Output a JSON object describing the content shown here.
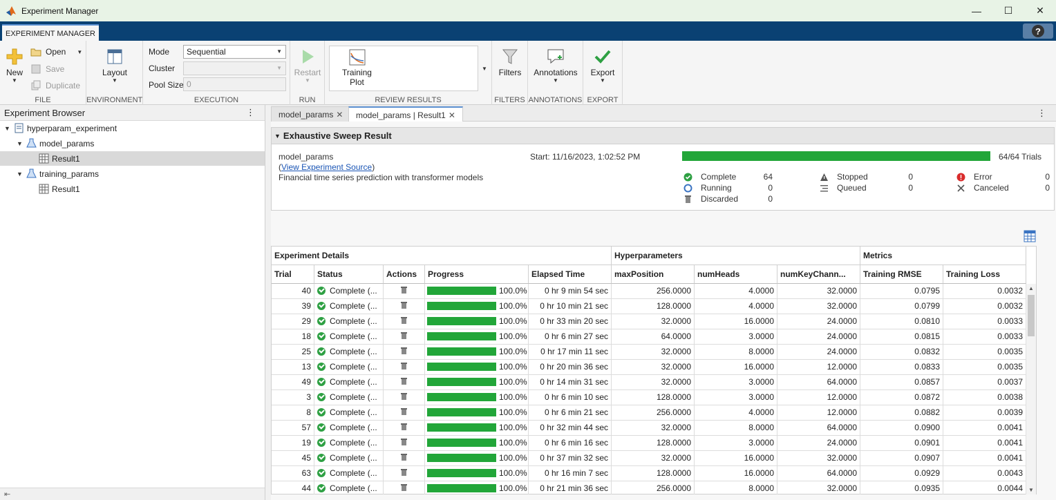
{
  "window": {
    "title": "Experiment Manager",
    "minimize": "—",
    "maximize": "☐",
    "close": "✕"
  },
  "app_tab": "EXPERIMENT MANAGER",
  "help": "?",
  "toolstrip": {
    "file": {
      "label": "FILE",
      "new": "New",
      "open": "Open",
      "save": "Save",
      "duplicate": "Duplicate"
    },
    "environment": {
      "label": "ENVIRONMENT",
      "layout": "Layout"
    },
    "execution": {
      "label": "EXECUTION",
      "mode_label": "Mode",
      "mode_value": "Sequential",
      "cluster_label": "Cluster",
      "cluster_value": "",
      "pool_label": "Pool Size",
      "pool_value": "0"
    },
    "run": {
      "label": "RUN",
      "restart": "Restart"
    },
    "review": {
      "label": "REVIEW RESULTS",
      "training_plot_1": "Training",
      "training_plot_2": "Plot"
    },
    "filters": {
      "label": "FILTERS",
      "button": "Filters"
    },
    "annotations": {
      "label": "ANNOTATIONS",
      "button": "Annotations"
    },
    "export": {
      "label": "EXPORT",
      "button": "Export"
    }
  },
  "browser": {
    "title": "Experiment Browser",
    "items": [
      {
        "label": "hyperparam_experiment"
      },
      {
        "label": "model_params"
      },
      {
        "label": "Result1"
      },
      {
        "label": "training_params"
      },
      {
        "label": "Result1"
      }
    ]
  },
  "doc_tabs": [
    {
      "label": "model_params"
    },
    {
      "label": "model_params | Result1"
    }
  ],
  "sweep": {
    "title": "Exhaustive Sweep Result",
    "experiment": "model_params",
    "link": "View Experiment Source",
    "description": "Financial time series prediction with transformer models",
    "start": "Start: 11/16/2023, 1:02:52 PM",
    "progress": 1.0,
    "trials": "64/64 Trials",
    "stats": {
      "complete_label": "Complete",
      "complete": "64",
      "running_label": "Running",
      "running": "0",
      "discarded_label": "Discarded",
      "discarded": "0",
      "stopped_label": "Stopped",
      "stopped": "0",
      "queued_label": "Queued",
      "queued": "0",
      "error_label": "Error",
      "error": "0",
      "canceled_label": "Canceled",
      "canceled": "0"
    },
    "colors": {
      "complete": "#2ea043",
      "error": "#d92c2c",
      "progress": "#22a639"
    }
  },
  "table": {
    "groups": [
      "Experiment Details",
      "Hyperparameters",
      "Metrics"
    ],
    "columns": [
      "Trial",
      "Status",
      "Actions",
      "Progress",
      "Elapsed Time",
      "maxPosition",
      "numHeads",
      "numKeyChann...",
      "Training RMSE",
      "Training Loss"
    ],
    "rows": [
      {
        "trial": "40",
        "status": "Complete (...",
        "progress": "100.0%",
        "elapsed": "0 hr 9 min 54 sec",
        "maxPosition": "256.0000",
        "numHeads": "4.0000",
        "numKey": "32.0000",
        "rmse": "0.0795",
        "loss": "0.0032"
      },
      {
        "trial": "39",
        "status": "Complete (...",
        "progress": "100.0%",
        "elapsed": "0 hr 10 min 21 sec",
        "maxPosition": "128.0000",
        "numHeads": "4.0000",
        "numKey": "32.0000",
        "rmse": "0.0799",
        "loss": "0.0032"
      },
      {
        "trial": "29",
        "status": "Complete (...",
        "progress": "100.0%",
        "elapsed": "0 hr 33 min 20 sec",
        "maxPosition": "32.0000",
        "numHeads": "16.0000",
        "numKey": "24.0000",
        "rmse": "0.0810",
        "loss": "0.0033"
      },
      {
        "trial": "18",
        "status": "Complete (...",
        "progress": "100.0%",
        "elapsed": "0 hr 6 min 27 sec",
        "maxPosition": "64.0000",
        "numHeads": "3.0000",
        "numKey": "24.0000",
        "rmse": "0.0815",
        "loss": "0.0033"
      },
      {
        "trial": "25",
        "status": "Complete (...",
        "progress": "100.0%",
        "elapsed": "0 hr 17 min 11 sec",
        "maxPosition": "32.0000",
        "numHeads": "8.0000",
        "numKey": "24.0000",
        "rmse": "0.0832",
        "loss": "0.0035"
      },
      {
        "trial": "13",
        "status": "Complete (...",
        "progress": "100.0%",
        "elapsed": "0 hr 20 min 36 sec",
        "maxPosition": "32.0000",
        "numHeads": "16.0000",
        "numKey": "12.0000",
        "rmse": "0.0833",
        "loss": "0.0035"
      },
      {
        "trial": "49",
        "status": "Complete (...",
        "progress": "100.0%",
        "elapsed": "0 hr 14 min 31 sec",
        "maxPosition": "32.0000",
        "numHeads": "3.0000",
        "numKey": "64.0000",
        "rmse": "0.0857",
        "loss": "0.0037"
      },
      {
        "trial": "3",
        "status": "Complete (...",
        "progress": "100.0%",
        "elapsed": "0 hr 6 min 10 sec",
        "maxPosition": "128.0000",
        "numHeads": "3.0000",
        "numKey": "12.0000",
        "rmse": "0.0872",
        "loss": "0.0038"
      },
      {
        "trial": "8",
        "status": "Complete (...",
        "progress": "100.0%",
        "elapsed": "0 hr 6 min 21 sec",
        "maxPosition": "256.0000",
        "numHeads": "4.0000",
        "numKey": "12.0000",
        "rmse": "0.0882",
        "loss": "0.0039"
      },
      {
        "trial": "57",
        "status": "Complete (...",
        "progress": "100.0%",
        "elapsed": "0 hr 32 min 44 sec",
        "maxPosition": "32.0000",
        "numHeads": "8.0000",
        "numKey": "64.0000",
        "rmse": "0.0900",
        "loss": "0.0041"
      },
      {
        "trial": "19",
        "status": "Complete (...",
        "progress": "100.0%",
        "elapsed": "0 hr 6 min 16 sec",
        "maxPosition": "128.0000",
        "numHeads": "3.0000",
        "numKey": "24.0000",
        "rmse": "0.0901",
        "loss": "0.0041"
      },
      {
        "trial": "45",
        "status": "Complete (...",
        "progress": "100.0%",
        "elapsed": "0 hr 37 min 32 sec",
        "maxPosition": "32.0000",
        "numHeads": "16.0000",
        "numKey": "32.0000",
        "rmse": "0.0907",
        "loss": "0.0041"
      },
      {
        "trial": "63",
        "status": "Complete (...",
        "progress": "100.0%",
        "elapsed": "0 hr 16 min 7 sec",
        "maxPosition": "128.0000",
        "numHeads": "16.0000",
        "numKey": "64.0000",
        "rmse": "0.0929",
        "loss": "0.0043"
      },
      {
        "trial": "44",
        "status": "Complete (...",
        "progress": "100.0%",
        "elapsed": "0 hr 21 min 36 sec",
        "maxPosition": "256.0000",
        "numHeads": "8.0000",
        "numKey": "32.0000",
        "rmse": "0.0935",
        "loss": "0.0044"
      }
    ]
  }
}
